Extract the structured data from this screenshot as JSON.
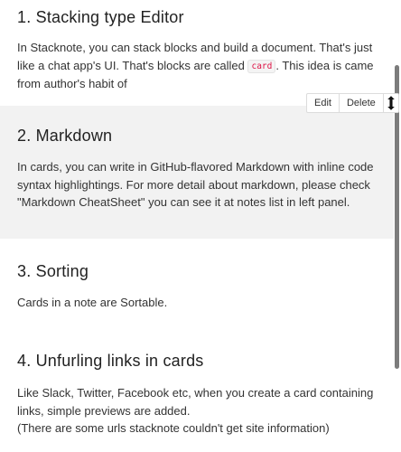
{
  "cards": [
    {
      "title": "1. Stacking type Editor",
      "body_before": "In Stacknote, you can stack blocks and build a document. That's just like a chat app's UI. That's blocks are called ",
      "inline_code": "card",
      "body_after": ". This idea is came from author's habit of"
    },
    {
      "title": "2. Markdown",
      "body": "In cards, you can write in GitHub-flavored Markdown with inline code syntax highlightings. For more detail about markdown, please check \"Markdown CheatSheet\" you can see it at notes list in left panel."
    },
    {
      "title": "3. Sorting",
      "body": "Cards in a note are Sortable."
    },
    {
      "title": "4. Unfurling links in cards",
      "body_lines": [
        "Like Slack, Twitter, Facebook etc, when you create a card containing links, simple previews are added.",
        "(There are some urls stacknote couldn't get site information)"
      ]
    }
  ],
  "toolbar": {
    "edit_label": "Edit",
    "delete_label": "Delete",
    "drag_icon": "vertical-resize-icon"
  },
  "colors": {
    "active_card_bg": "#f2f2f2",
    "inline_code_text": "#dd1144",
    "scrollbar_thumb": "#7c7c7c",
    "text": "#333333"
  }
}
